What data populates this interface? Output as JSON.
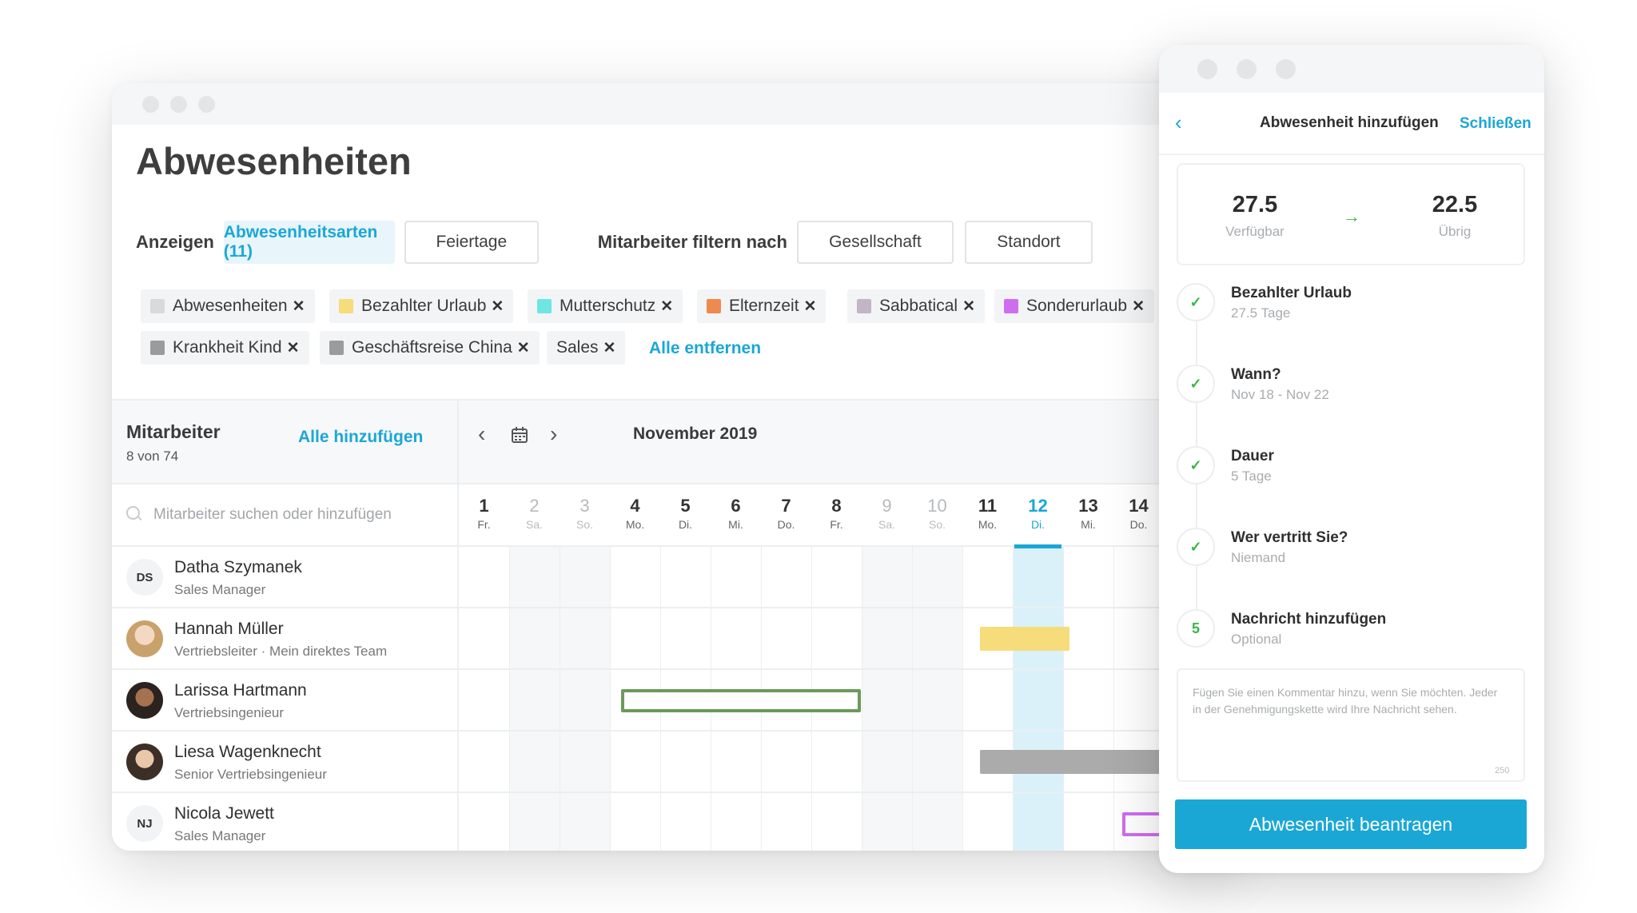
{
  "main": {
    "title": "Abwesenheiten",
    "show_label": "Anzeigen",
    "btn_absence_types": "Abwesenheitsarten (11)",
    "btn_holidays": "Feiertage",
    "filter_label": "Mitarbeiter filtern nach",
    "btn_company": "Gesellschaft",
    "btn_location": "Standort",
    "tags": [
      {
        "label": "Abwesenheiten",
        "color": "#d9dadc"
      },
      {
        "label": "Bezahlter Urlaub",
        "color": "#f6dc7a"
      },
      {
        "label": "Mutterschutz",
        "color": "#6ee6e4"
      },
      {
        "label": "Elternzeit",
        "color": "#ef8a4f"
      },
      {
        "label": "Sabbatical",
        "color": "#c3b5c7"
      },
      {
        "label": "Sonderurlaub",
        "color": "#cf6df0"
      },
      {
        "label": "Krankheit Kind",
        "color": "#9a9b9c"
      },
      {
        "label": "Geschäftsreise China",
        "color": "#9a9b9c"
      },
      {
        "label": "Sales",
        "color": ""
      }
    ],
    "tag_close": "✕",
    "remove_all": "Alle entfernen",
    "employees_title": "Mitarbeiter",
    "employees_count": "8 von 74",
    "add_all": "Alle hinzufügen",
    "search_placeholder": "Mitarbeiter suchen oder hinzufügen",
    "month": "November 2019",
    "nav_prev": "‹",
    "nav_next": "›",
    "days": [
      {
        "num": "1",
        "wd": "Fr."
      },
      {
        "num": "2",
        "wd": "Sa."
      },
      {
        "num": "3",
        "wd": "So."
      },
      {
        "num": "4",
        "wd": "Mo."
      },
      {
        "num": "5",
        "wd": "Di."
      },
      {
        "num": "6",
        "wd": "Mi."
      },
      {
        "num": "7",
        "wd": "Do."
      },
      {
        "num": "8",
        "wd": "Fr."
      },
      {
        "num": "9",
        "wd": "Sa."
      },
      {
        "num": "10",
        "wd": "So."
      },
      {
        "num": "11",
        "wd": "Mo."
      },
      {
        "num": "12",
        "wd": "Di."
      },
      {
        "num": "13",
        "wd": "Mi."
      },
      {
        "num": "14",
        "wd": "Do."
      }
    ],
    "employees": [
      {
        "initials": "DS",
        "name": "Datha Szymanek",
        "role": "Sales Manager"
      },
      {
        "initials": "",
        "name": "Hannah Müller",
        "role": "Vertriebsleiter · Mein direktes Team"
      },
      {
        "initials": "",
        "name": "Larissa Hartmann",
        "role": "Vertriebsingenieur"
      },
      {
        "initials": "",
        "name": "Liesa Wagenknecht",
        "role": "Senior Vertriebsingenieur"
      },
      {
        "initials": "NJ",
        "name": "Nicola Jewett",
        "role": "Sales Manager"
      }
    ]
  },
  "panel": {
    "back": "‹",
    "title": "Abwesenheit hinzufügen",
    "close": "Schließen",
    "available_value": "27.5",
    "available_label": "Verfügbar",
    "remaining_value": "22.5",
    "remaining_label": "Übrig",
    "arrow": "→",
    "steps": [
      {
        "mark": "✓",
        "title": "Bezahlter Urlaub",
        "sub": "27.5 Tage"
      },
      {
        "mark": "✓",
        "title": "Wann?",
        "sub": "Nov 18 - Nov 22"
      },
      {
        "mark": "✓",
        "title": "Dauer",
        "sub": "5 Tage"
      },
      {
        "mark": "✓",
        "title": "Wer vertritt Sie?",
        "sub": "Niemand"
      },
      {
        "mark": "5",
        "title": "Nachricht hinzufügen",
        "sub": "Optional"
      }
    ],
    "comment_placeholder": "Fügen Sie einen Kommentar hinzu, wenn Sie möchten. Jeder in der Genehmigungskette wird Ihre Nachricht sehen.",
    "char_limit": "250",
    "submit": "Abwesenheit beantragen"
  },
  "colors": {
    "accent": "#1aa7d6",
    "success": "#39b54a",
    "vacation": "#f6dc7a",
    "trip": "#6b9a5b",
    "sick_child": "#ababab",
    "special": "#cf6df0",
    "today_column": "#dbf1fa",
    "weekend_column": "#f5f7f8"
  }
}
